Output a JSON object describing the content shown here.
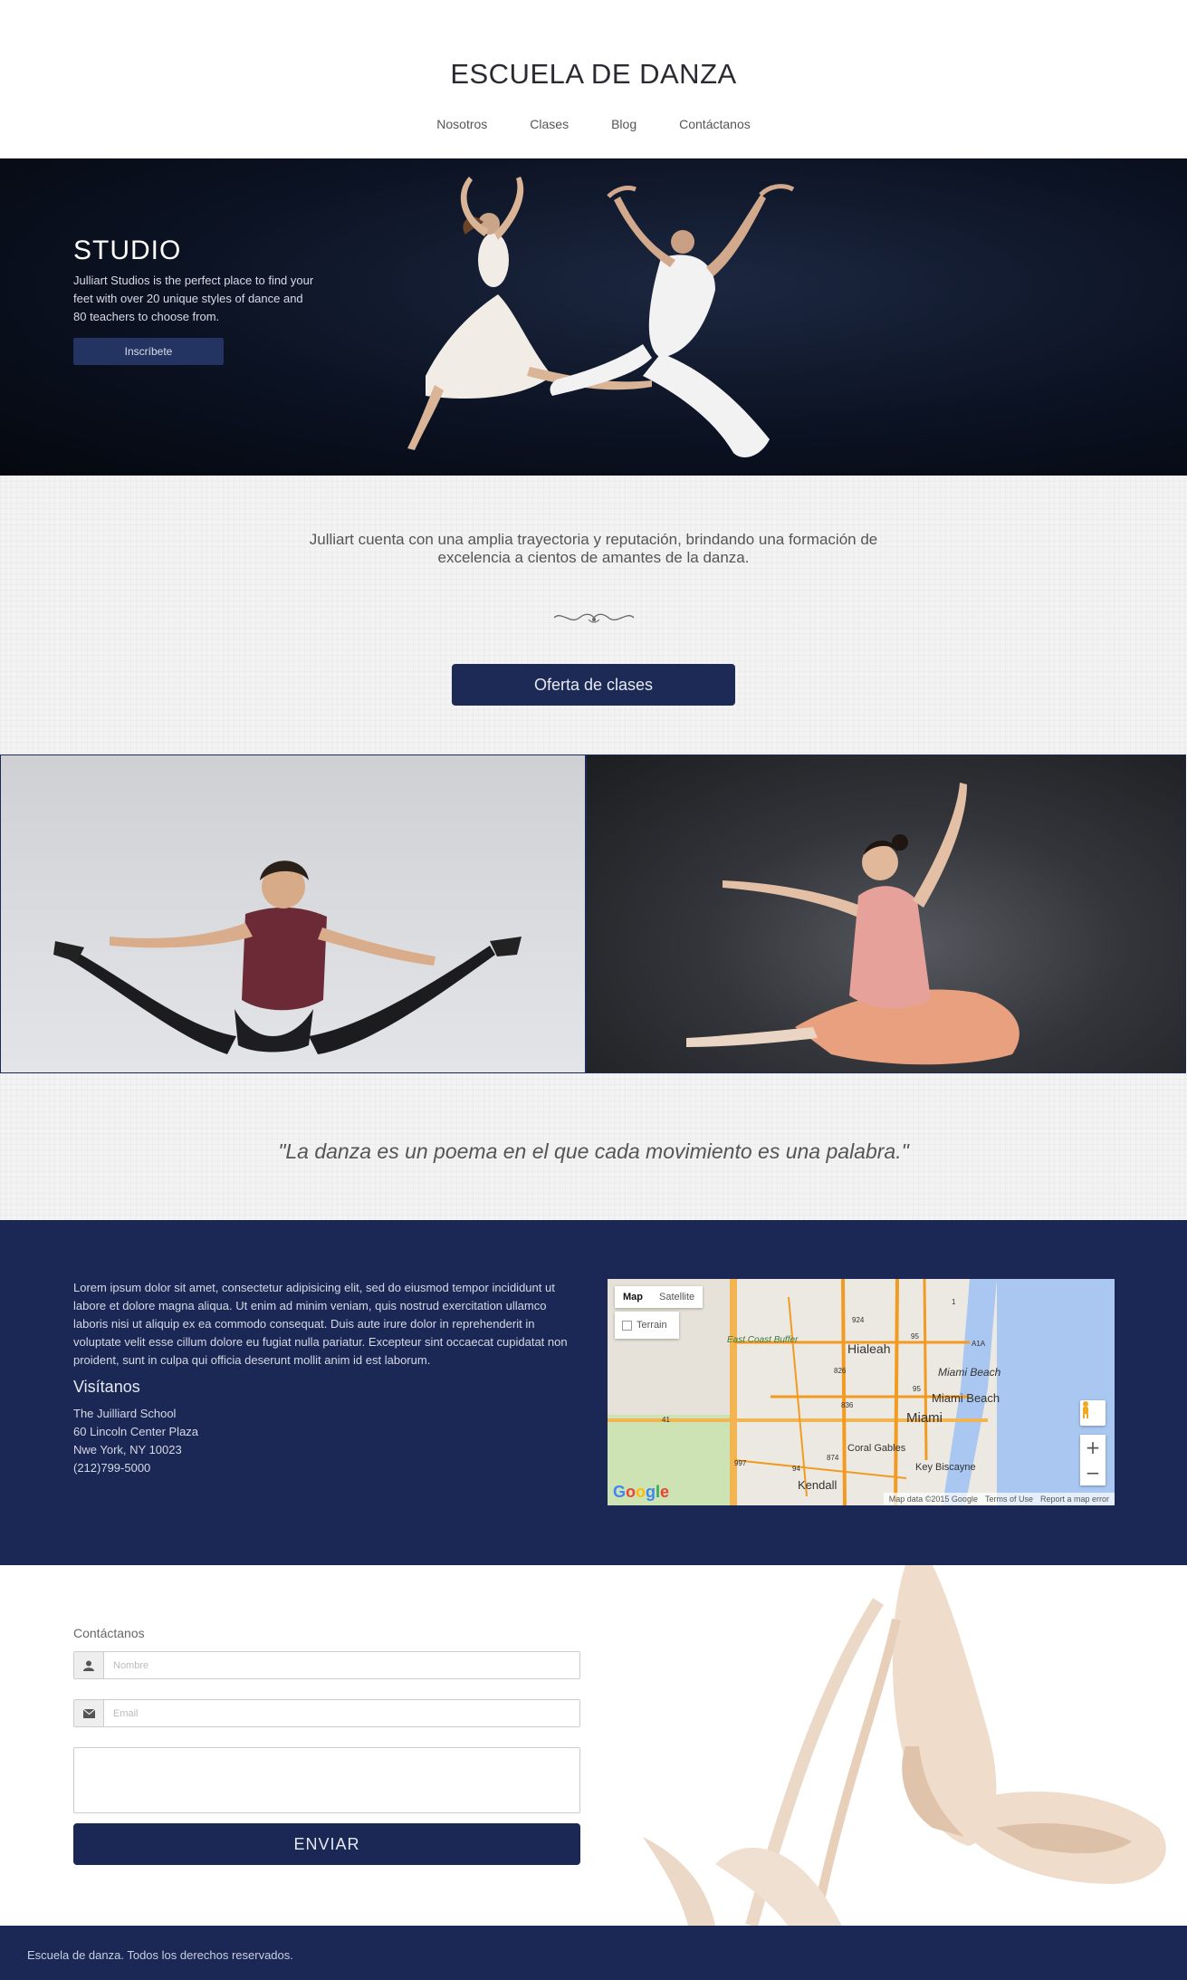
{
  "header": {
    "title": "ESCUELA DE DANZA",
    "nav": [
      "Nosotros",
      "Clases",
      "Blog",
      "Contáctanos"
    ]
  },
  "hero": {
    "title": "STUDIO",
    "description": "Julliart Studios is the perfect place to find your feet with over 20 unique styles of dance and 80 teachers to choose from.",
    "button_label": "Inscríbete"
  },
  "intro": {
    "text": "Julliart cuenta con una amplia trayectoria y reputación, brindando una formación de excelencia a cientos de amantes de la danza.",
    "button_label": "Oferta de clases"
  },
  "quote": "\"La danza es un poema en el que cada movimiento es una palabra.\"",
  "info": {
    "lorem": "Lorem ipsum dolor sit amet, consectetur adipisicing elit, sed do eiusmod tempor incididunt ut labore et dolore magna aliqua. Ut enim ad minim veniam, quis nostrud exercitation ullamco laboris nisi ut aliquip ex ea commodo consequat. Duis aute irure dolor in reprehenderit in voluptate velit esse cillum dolore eu fugiat nulla pariatur. Excepteur sint occaecat cupidatat non proident, sunt in culpa qui officia deserunt mollit anim id est laborum.",
    "visit_title": "Visítanos",
    "address": [
      "The Juilliard School",
      "60 Lincoln Center Plaza",
      "Nwe York, NY 10023",
      "(212)799-5000"
    ]
  },
  "map": {
    "tab_map": "Map",
    "tab_satellite": "Satellite",
    "terrain_label": "Terrain",
    "places": [
      "Hialeah",
      "Miami Beach",
      "Miami Beach",
      "Miami",
      "Coral Gables",
      "Key Biscayne",
      "Kendall",
      "East Coast Buffer"
    ],
    "route_labels": [
      "924",
      "95",
      "826",
      "836",
      "874",
      "997",
      "94",
      "41",
      "1",
      "A1A",
      "95"
    ],
    "footer": [
      "Map data ©2015 Google",
      "Terms of Use",
      "Report a map error"
    ],
    "logo": "Google"
  },
  "contact": {
    "label": "Contáctanos",
    "name_placeholder": "Nombre",
    "email_placeholder": "Email",
    "send_label": "ENVIAR"
  },
  "footer": {
    "text": "Escuela de danza. Todos los derechos reservados."
  },
  "colors": {
    "navy": "#1b2754",
    "button": "#1d2a55"
  }
}
